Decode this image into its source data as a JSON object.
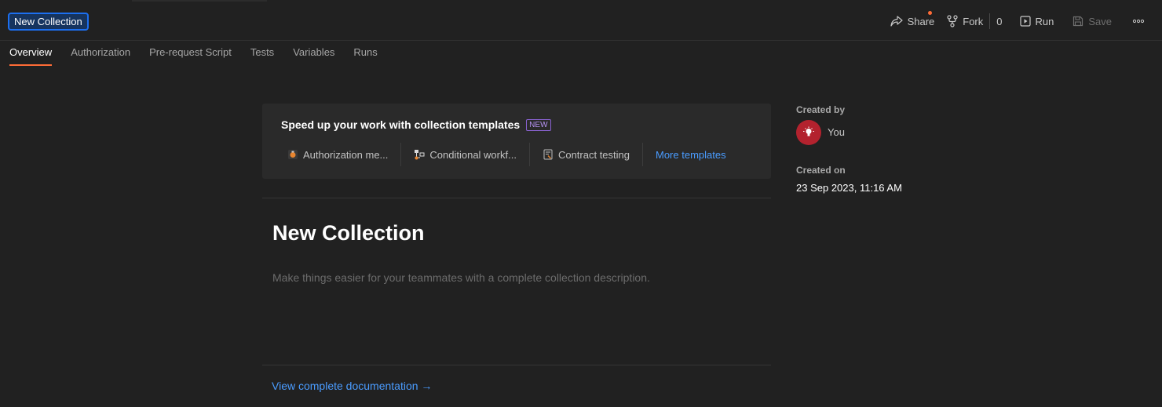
{
  "header": {
    "collection_title": "New Collection",
    "actions": {
      "share_label": "Share",
      "fork_label": "Fork",
      "fork_count": "0",
      "run_label": "Run",
      "save_label": "Save",
      "more_label": "ooo"
    }
  },
  "tabs": [
    {
      "label": "Overview",
      "active": true
    },
    {
      "label": "Authorization",
      "active": false
    },
    {
      "label": "Pre-request Script",
      "active": false
    },
    {
      "label": "Tests",
      "active": false
    },
    {
      "label": "Variables",
      "active": false
    },
    {
      "label": "Runs",
      "active": false
    }
  ],
  "templates": {
    "title": "Speed up your work with collection templates",
    "badge": "NEW",
    "items": [
      {
        "label": "Authorization me...",
        "icon": "authorization-template-icon"
      },
      {
        "label": "Conditional workf...",
        "icon": "conditional-workflow-template-icon"
      },
      {
        "label": "Contract testing",
        "icon": "contract-testing-template-icon"
      }
    ],
    "more_label": "More templates"
  },
  "overview": {
    "name": "New Collection",
    "description_placeholder": "Make things easier for your teammates with a complete collection description.",
    "doc_link": "View complete documentation →"
  },
  "info": {
    "created_by_label": "Created by",
    "creator": "You",
    "created_on_label": "Created on",
    "created_on": "23 Sep 2023, 11:16 AM"
  },
  "colors": {
    "accent": "#ff6c37",
    "link": "#4a9cff",
    "focus_border": "#1c6ff0",
    "avatar": "#b3222e"
  }
}
